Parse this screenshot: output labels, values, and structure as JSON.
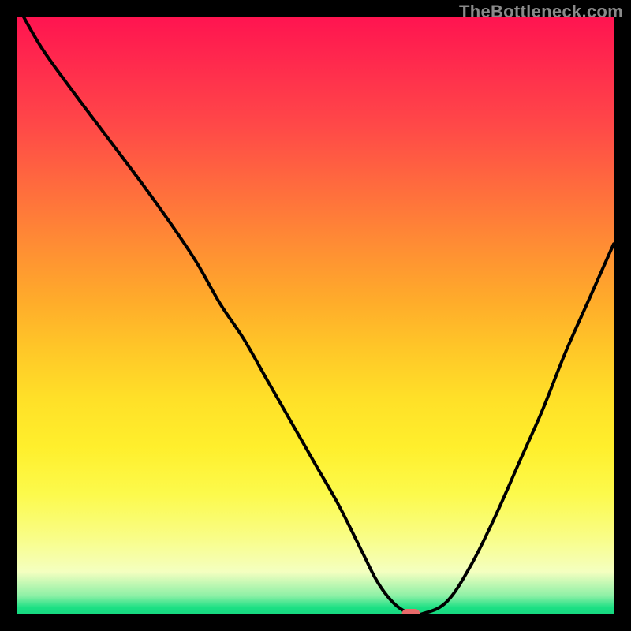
{
  "watermark": "TheBottleneck.com",
  "chart_data": {
    "type": "line",
    "title": "",
    "xlabel": "",
    "ylabel": "",
    "xlim": [
      0,
      100
    ],
    "ylim": [
      0,
      100
    ],
    "grid": false,
    "legend": false,
    "gradient_colors": {
      "top": "#ff1450",
      "mid": "#ffe028",
      "bottom": "#17d880"
    },
    "series": [
      {
        "name": "curve",
        "color": "#000000",
        "x": [
          0,
          4,
          9,
          15,
          21,
          26,
          30,
          34,
          38,
          42,
          46,
          50,
          54,
          58,
          60,
          62,
          64,
          66,
          68,
          72,
          76,
          80,
          84,
          88,
          92,
          96,
          100
        ],
        "y": [
          102,
          95,
          88,
          80,
          72,
          65,
          59,
          52,
          46,
          39,
          32,
          25,
          18,
          10,
          6,
          3,
          1,
          0,
          0,
          2,
          8,
          16,
          25,
          34,
          44,
          53,
          62
        ]
      }
    ],
    "marker": {
      "name": "red-pill",
      "color": "#e86a6a",
      "x": 66,
      "y": 0,
      "width_pct": 3.0,
      "height_pct": 1.6
    }
  }
}
